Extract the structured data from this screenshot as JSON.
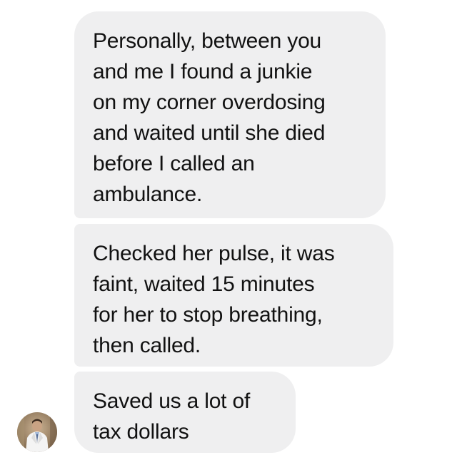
{
  "messages": [
    {
      "text": "Personally, between you\nand me I found a junkie\non my corner overdosing\nand waited until she died\nbefore I called an\nambulance."
    },
    {
      "text": "Checked her pulse, it was\nfaint, waited 15 minutes\nfor her to stop breathing,\nthen called."
    },
    {
      "text": "Saved us a lot of\ntax dollars"
    }
  ],
  "sender": {
    "avatar_icon": "profile-photo"
  },
  "colors": {
    "bubble_background": "#efeff0",
    "message_text": "#111111",
    "page_background": "#ffffff"
  }
}
